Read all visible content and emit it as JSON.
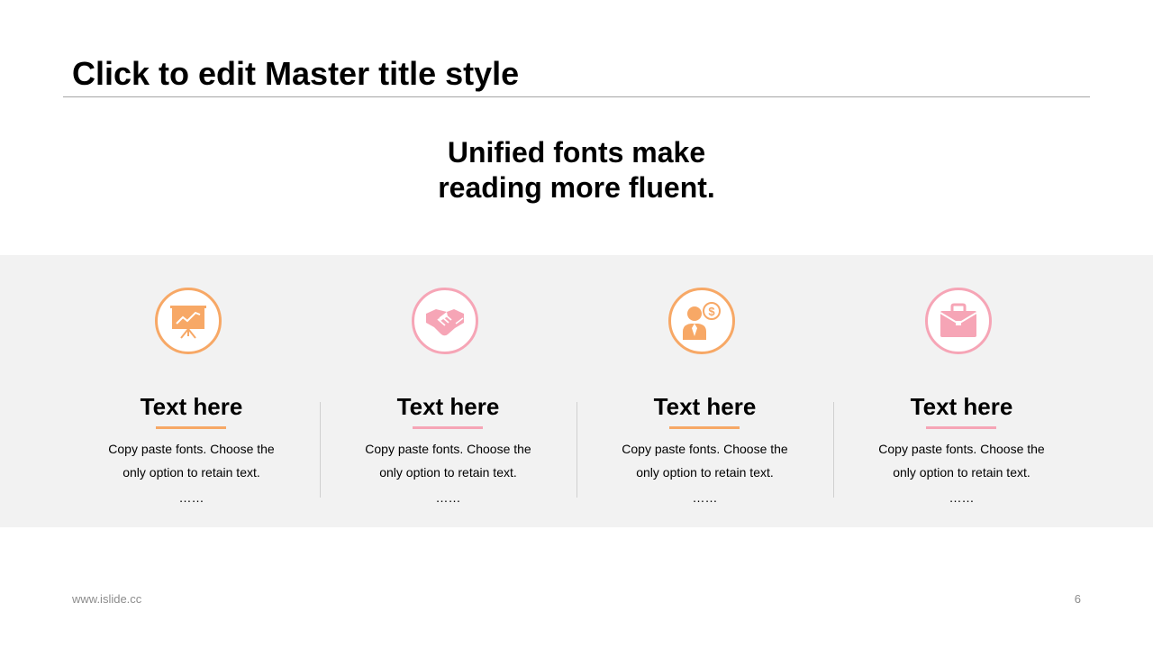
{
  "slide": {
    "title": "Click to edit Master title style",
    "subtitle_lines": [
      "Unified fonts make",
      "reading more fluent."
    ]
  },
  "colors": {
    "orange": "#f7a866",
    "pink": "#f6a5b6",
    "band_background": "#f2f2f2",
    "rule": "#a6a6a6"
  },
  "cards": [
    {
      "icon": "presentation-chart-icon",
      "accent": "orange",
      "title": "Text here",
      "desc_line1": "Copy paste fonts. Choose the",
      "desc_line2": "only option to retain text.",
      "more": "……"
    },
    {
      "icon": "handshake-icon",
      "accent": "pink",
      "title": "Text here",
      "desc_line1": "Copy paste fonts. Choose the",
      "desc_line2": "only option to retain text.",
      "more": "……"
    },
    {
      "icon": "businessman-dollar-icon",
      "accent": "orange",
      "title": "Text here",
      "desc_line1": "Copy paste fonts. Choose the",
      "desc_line2": "only option to retain text.",
      "more": "……"
    },
    {
      "icon": "briefcase-icon",
      "accent": "pink",
      "title": "Text here",
      "desc_line1": "Copy paste fonts. Choose the",
      "desc_line2": "only option to retain text.",
      "more": "……"
    }
  ],
  "footer": {
    "url": "www.islide.cc",
    "page_number": "6"
  }
}
